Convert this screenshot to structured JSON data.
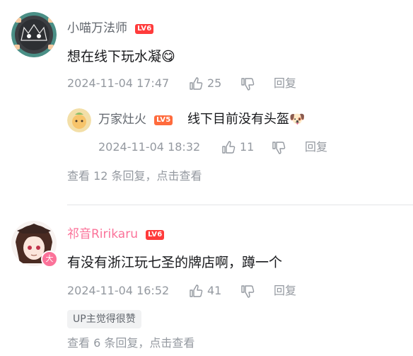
{
  "comments": [
    {
      "username": "小喵万法师",
      "level": "LV6",
      "text": "想在线下玩水凝",
      "emoji": "😋",
      "time": "2024-11-04 17:47",
      "likes": "25",
      "reply_label": "回复",
      "replies": [
        {
          "username": "万家灶火",
          "level": "LV5",
          "text": "线下目前没有头盔",
          "emoji": "🐶",
          "time": "2024-11-04 18:32",
          "likes": "11",
          "reply_label": "回复"
        }
      ],
      "view_more": "查看 12 条回复，点击查看"
    },
    {
      "username": "祁音Ririkaru",
      "level": "LV6",
      "text": "有没有浙江玩七圣的牌店啊，蹲一个",
      "time": "2024-11-04 16:52",
      "likes": "41",
      "reply_label": "回复",
      "tag": "UP主觉得很赞",
      "view_more": "查看 6 条回复，点击查看",
      "badge": "大"
    }
  ],
  "colors": {
    "username": "#61666d",
    "username_vip": "#fb7299",
    "meta": "#9499a0",
    "text": "#18191c",
    "level_orange": "#ff6b3d",
    "level_red": "#ff3b3b"
  }
}
